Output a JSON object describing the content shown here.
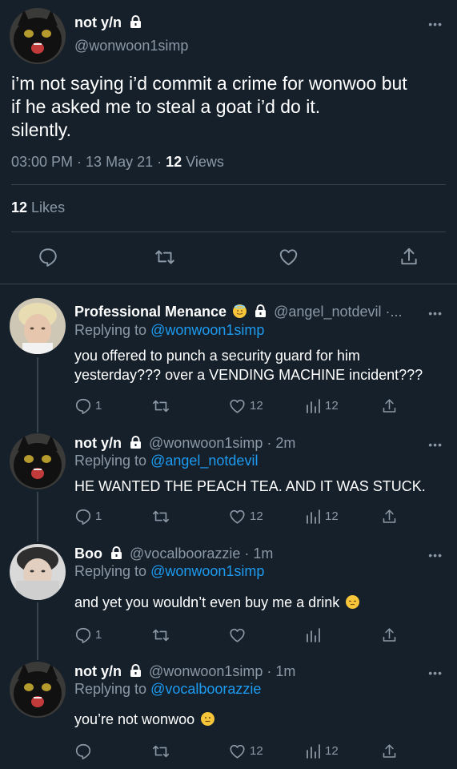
{
  "main_tweet": {
    "display_name": "not y/n",
    "handle": "@wonwoon1simp",
    "text_lines": [
      "i’m not saying i’d commit a crime for wonwoo but",
      "if he asked me to steal a goat i’d do it.",
      "silently."
    ],
    "time": "03:00 PM",
    "sep1": " · ",
    "date": "13 May 21",
    "sep2": " · ",
    "views_count": "12",
    "views_label": "Views",
    "likes_count": "12",
    "likes_label": "Likes"
  },
  "replies": [
    {
      "display_name": "Professional Menance",
      "handle": "@angel_notdevil ·...",
      "replying_prefix": "Replying to",
      "replying_to": "@wonwoon1simp",
      "text_lines": [
        "you offered to punch a security guard for him",
        "yesterday??? over a VENDING MACHINE incident???"
      ],
      "reply_count": "1",
      "like_count": "12",
      "view_count": "12"
    },
    {
      "display_name": "not y/n",
      "handle": "@wonwoon1simp · 2m",
      "replying_prefix": "Replying to",
      "replying_to": "@angel_notdevil",
      "text_lines": [
        "HE WANTED THE PEACH TEA. AND IT WAS STUCK."
      ],
      "reply_count": "1",
      "like_count": "12",
      "view_count": "12"
    },
    {
      "display_name": "Boo",
      "handle": "@vocalboorazzie · 1m",
      "replying_prefix": "Replying to",
      "replying_to": "@wonwoon1simp",
      "text_lines": [
        "and yet you wouldn’t even buy me a drink"
      ],
      "reply_count": "1",
      "like_count": "",
      "view_count": ""
    },
    {
      "display_name": "not y/n",
      "handle": "@wonwoon1simp · 1m",
      "replying_prefix": "Replying to",
      "replying_to": "@vocalboorazzie",
      "text_lines": [
        "you’re not wonwoo"
      ],
      "reply_count": "",
      "like_count": "12",
      "view_count": "12"
    }
  ],
  "more_label": "•••",
  "colors": {
    "background": "#15202b",
    "muted": "#8b98a5",
    "link": "#1d9bf0",
    "divider": "#38444d"
  },
  "icons": [
    "lock-icon",
    "reply-icon",
    "retweet-icon",
    "heart-icon",
    "share-icon",
    "views-icon",
    "more-icon",
    "emoji-icon"
  ]
}
